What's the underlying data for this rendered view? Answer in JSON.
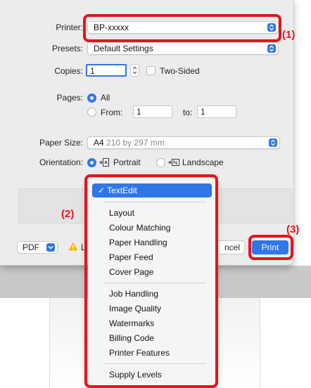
{
  "colors": {
    "accent": "#2f76e6",
    "annotation": "#e3141f",
    "dialog_bg": "#ececec"
  },
  "printer": {
    "label": "Printer:",
    "value": "BP-xxxxx"
  },
  "presets": {
    "label": "Presets:",
    "value": "Default Settings"
  },
  "copies": {
    "label": "Copies:",
    "value": "1",
    "two_sided_label": "Two-Sided"
  },
  "pages": {
    "label": "Pages:",
    "all_label": "All",
    "from_label": "From:",
    "from_value": "1",
    "to_label": "to:",
    "to_value": "1"
  },
  "paper_size": {
    "label": "Paper Size:",
    "value": "A4",
    "dimensions": "210 by 297 mm"
  },
  "orientation": {
    "label": "Orientation:",
    "portrait_label": "Portrait",
    "landscape_label": "Landscape"
  },
  "footer": {
    "pdf_label": "PDF",
    "warning_fragment": "L",
    "cancel_fragment": "ncel",
    "print_label": "Print"
  },
  "menu": {
    "selected": "✓ TextEdit",
    "group1": [
      "Layout",
      "Colour Matching",
      "Paper Handling",
      "Paper Feed",
      "Cover Page"
    ],
    "group2": [
      "Job Handling",
      "Image Quality",
      "Watermarks",
      "Billing Code",
      "Printer Features"
    ],
    "group3": [
      "Supply Levels"
    ]
  },
  "annotations": {
    "n1": "(1)",
    "n2": "(2)",
    "n3": "(3)"
  }
}
